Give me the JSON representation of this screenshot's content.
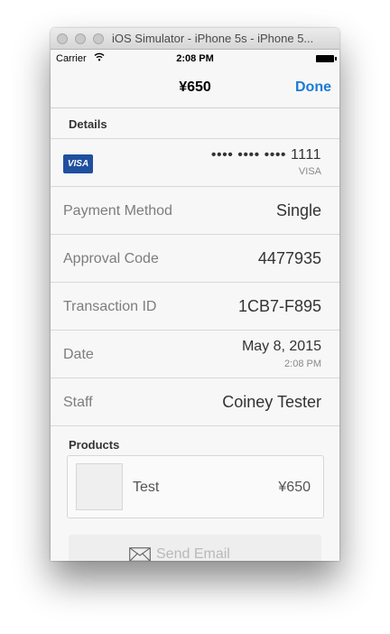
{
  "window": {
    "title": "iOS Simulator - iPhone 5s - iPhone 5..."
  },
  "status_bar": {
    "carrier": "Carrier",
    "time": "2:08 PM"
  },
  "nav": {
    "title": "¥650",
    "done_label": "Done"
  },
  "details": {
    "header": "Details",
    "card_brand_badge": "VISA",
    "card_masked": "•••• •••• •••• 1111",
    "card_brand": "VISA",
    "rows": [
      {
        "label": "Payment Method",
        "value": "Single"
      },
      {
        "label": "Approval Code",
        "value": "4477935"
      },
      {
        "label": "Transaction ID",
        "value": "1CB7-F895"
      },
      {
        "label": "Date",
        "value": "May 8, 2015",
        "sub": "2:08 PM"
      },
      {
        "label": "Staff",
        "value": "Coiney Tester"
      }
    ]
  },
  "products": {
    "header": "Products",
    "items": [
      {
        "name": "Test",
        "price": "¥650"
      }
    ]
  },
  "actions": {
    "send_email_label": "Send Email"
  },
  "colors": {
    "accent": "#1a7bd6",
    "visa": "#1f4f9e"
  }
}
